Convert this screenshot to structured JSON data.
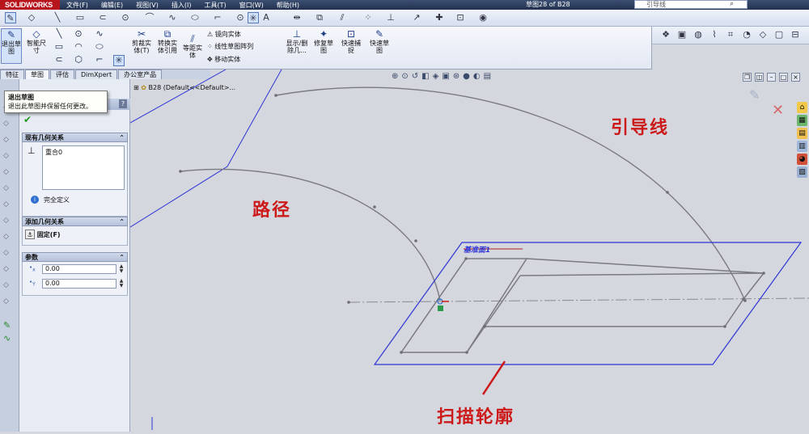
{
  "app": {
    "logo": "SOLIDWORKS",
    "menu": [
      "文件(F)",
      "编辑(E)",
      "视图(V)",
      "插入(I)",
      "工具(T)",
      "窗口(W)",
      "帮助(H)"
    ],
    "document_title": "草图28 of B28",
    "search_placeholder": "引导线"
  },
  "command_manager": {
    "exit_sketch": "退出草图",
    "smart_dimension": "智能尺寸",
    "trim": "剪裁实体(T)",
    "convert": "转换实体引用",
    "offset": "等距实体",
    "mirror": "镜向实体",
    "linear_pattern": "线性草图阵列",
    "move": "移动实体",
    "show_delete": "显示/删除几...",
    "repair": "修复草图",
    "quick_snap": "快速捕捉",
    "rapid_sketch": "快速草图"
  },
  "tabs": [
    "特征",
    "草图",
    "评估",
    "DimXpert",
    "办公室产品"
  ],
  "tooltip": {
    "title": "退出草图",
    "body": "退出此草图并保留任何更改。"
  },
  "property_manager": {
    "existing_relations": {
      "header": "现有几何关系",
      "items": [
        "重合0"
      ],
      "status": "完全定义"
    },
    "add_relations": {
      "header": "添加几何关系",
      "fix_label": "固定(F)"
    },
    "parameters": {
      "header": "参数",
      "x_label": "x",
      "x_value": "0.00",
      "y_label": "Y",
      "y_value": "0.00"
    }
  },
  "graphics": {
    "tree_label": "B28  (Default<<Default>...",
    "plane_label": "基准面1",
    "annotations": {
      "guide_line": "引导线",
      "path": "路径",
      "sweep_profile": "扫描轮廓"
    },
    "colors": {
      "plane": "#2f34d6",
      "sketch": "#6e6e74",
      "annotation": "#cc1a1a"
    }
  }
}
